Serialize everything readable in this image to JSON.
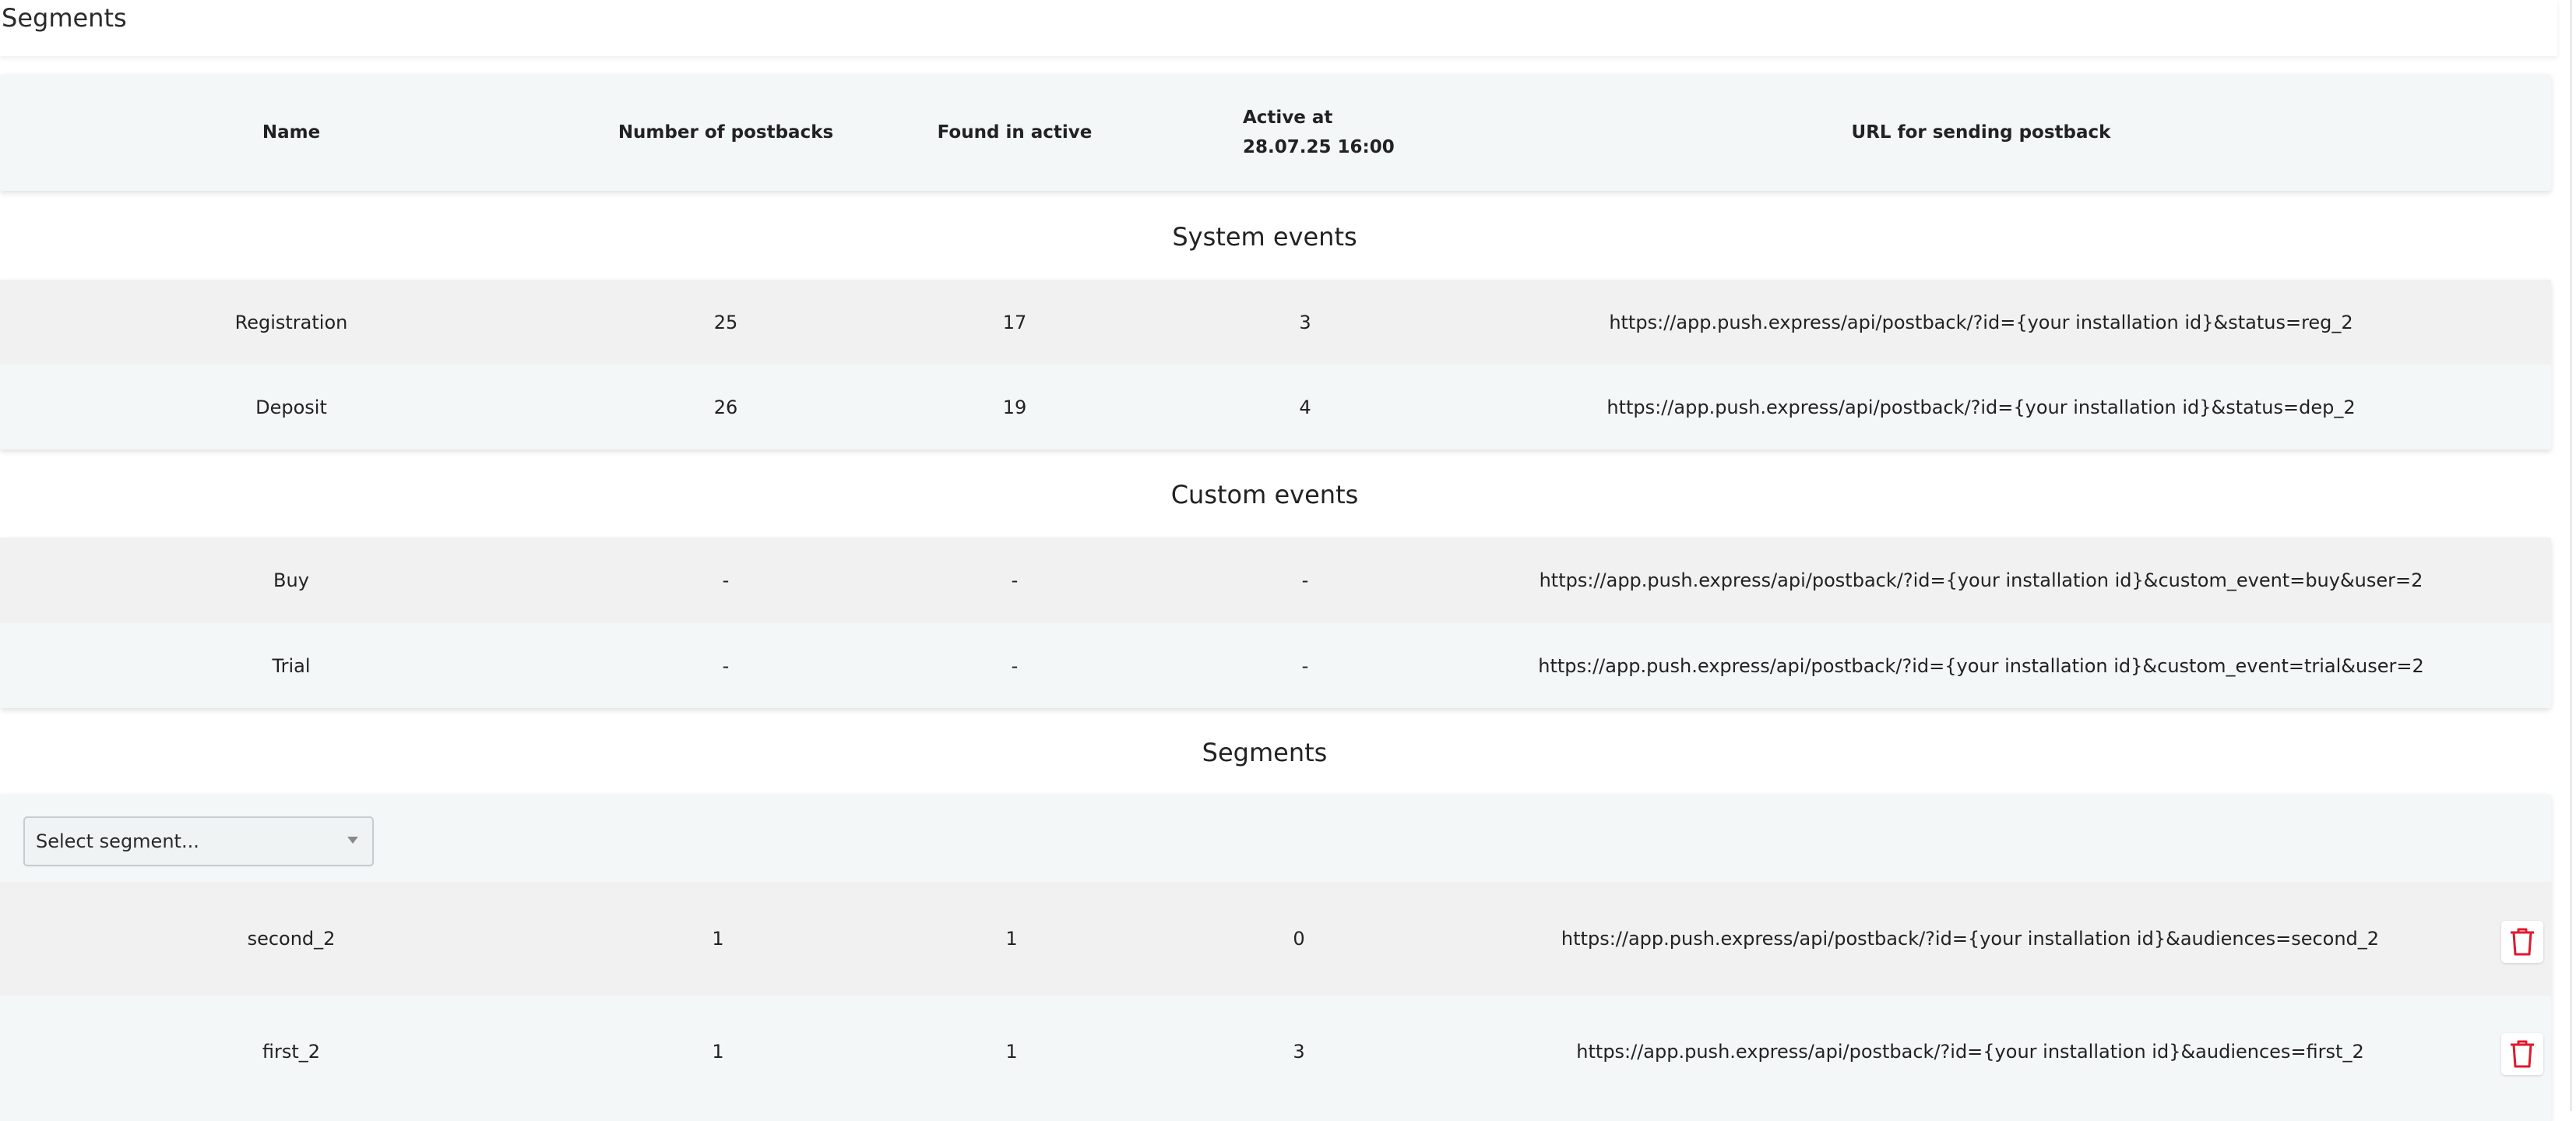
{
  "page": {
    "title": "Segments"
  },
  "columns": {
    "name": "Name",
    "postbacks": "Number of postbacks",
    "found": "Found in active",
    "active_at_line1": "Active at",
    "active_at_line2": "28.07.25 16:00",
    "url": "URL for sending postback"
  },
  "sections": {
    "system": "System events",
    "custom": "Custom events",
    "segments": "Segments"
  },
  "system_events": [
    {
      "name": "Registration",
      "postbacks": "25",
      "found": "17",
      "active": "3",
      "url": "https://app.push.express/api/postback/?id={your installation id}&status=reg_2"
    },
    {
      "name": "Deposit",
      "postbacks": "26",
      "found": "19",
      "active": "4",
      "url": "https://app.push.express/api/postback/?id={your installation id}&status=dep_2"
    }
  ],
  "custom_events": [
    {
      "name": "Buy",
      "postbacks": "-",
      "found": "-",
      "active": "-",
      "url": "https://app.push.express/api/postback/?id={your installation id}&custom_event=buy&user=2"
    },
    {
      "name": "Trial",
      "postbacks": "-",
      "found": "-",
      "active": "-",
      "url": "https://app.push.express/api/postback/?id={your installation id}&custom_event=trial&user=2"
    }
  ],
  "segment_select": {
    "placeholder": "Select segment..."
  },
  "segments": [
    {
      "name": "second_2",
      "postbacks": "1",
      "found": "1",
      "active": "0",
      "url": "https://app.push.express/api/postback/?id={your installation id}&audiences=second_2"
    },
    {
      "name": "first_2",
      "postbacks": "1",
      "found": "1",
      "active": "3",
      "url": "https://app.push.express/api/postback/?id={your installation id}&audiences=first_2"
    }
  ],
  "icons": {
    "delete": "trash-icon"
  },
  "colors": {
    "delete_icon": "#e0182d",
    "row_gray": "#f1f1f1",
    "row_light": "#f3f7f8"
  }
}
